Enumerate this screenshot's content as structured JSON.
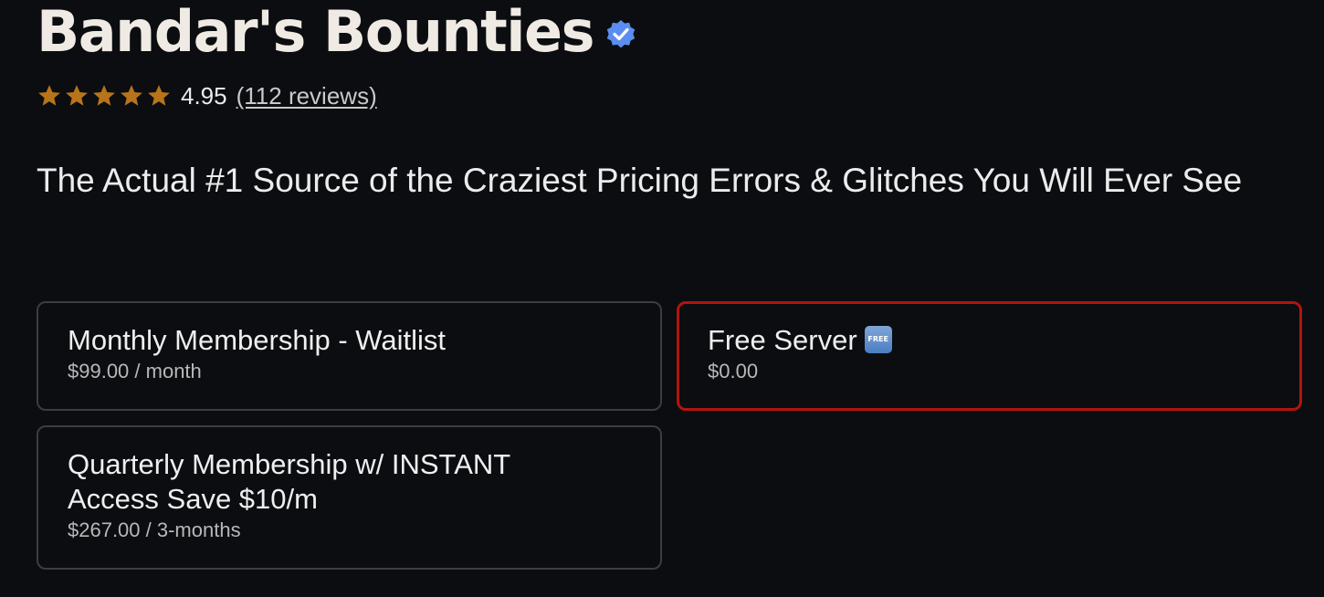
{
  "header": {
    "title": "Bandar's Bounties",
    "verified_icon": "verified-badge-icon",
    "accent_color": "#5b8df0"
  },
  "rating": {
    "stars": 5,
    "star_color": "#b8741a",
    "value": "4.95",
    "reviews_label": "(112 reviews)"
  },
  "tagline": "The Actual #1 Source of the Craziest Pricing Errors & Glitches You Will Ever See",
  "plans": [
    {
      "title": "Monthly Membership - Waitlist",
      "price": "$99.00 / month",
      "selected": false
    },
    {
      "title": "Free Server",
      "badge": "FREE",
      "price": "$0.00",
      "selected": true
    },
    {
      "title": "Quarterly Membership w/ INSTANT Access Save $10/m",
      "price": "$267.00 / 3-months",
      "selected": false
    }
  ],
  "colors": {
    "background": "#0b0d10",
    "card_border": "#3a3d42",
    "selected_border": "#b3140f"
  }
}
